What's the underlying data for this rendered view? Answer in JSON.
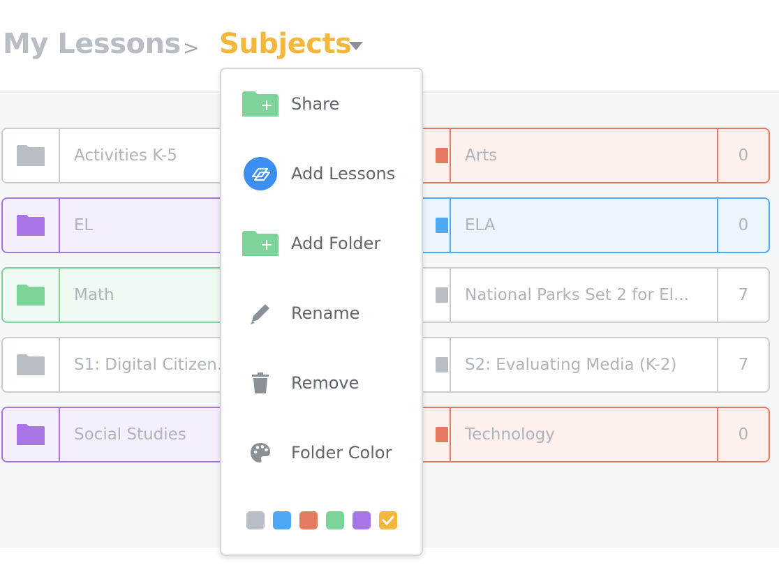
{
  "breadcrumb": {
    "root": "My Lessons",
    "separator": ">",
    "current": "Subjects"
  },
  "folders_left": [
    {
      "name": "Activities K-5",
      "theme": "gray"
    },
    {
      "name": "EL",
      "theme": "purple"
    },
    {
      "name": "Math",
      "theme": "green"
    },
    {
      "name": "S1: Digital Citizenship",
      "theme": "gray"
    },
    {
      "name": "Social Studies",
      "theme": "purple"
    }
  ],
  "folders_right": [
    {
      "name": "Arts",
      "count": "0",
      "theme": "red"
    },
    {
      "name": "ELA",
      "count": "0",
      "theme": "blue"
    },
    {
      "name": "National Parks Set 2 for El...",
      "count": "7",
      "theme": "gray"
    },
    {
      "name": "S2: Evaluating Media (K-2)",
      "count": "7",
      "theme": "gray"
    },
    {
      "name": "Technology",
      "count": "0",
      "theme": "red"
    }
  ],
  "menu": {
    "items": [
      {
        "label": "Share",
        "icon": "folder-plus-icon"
      },
      {
        "label": "Add Lessons",
        "icon": "nearpod-logo-icon"
      },
      {
        "label": "Add Folder",
        "icon": "folder-plus-icon"
      },
      {
        "label": "Rename",
        "icon": "pencil-icon"
      },
      {
        "label": "Remove",
        "icon": "trash-icon"
      },
      {
        "label": "Folder Color",
        "icon": "palette-icon"
      }
    ],
    "swatches": [
      {
        "color": "#b9bec4",
        "selected": false
      },
      {
        "color": "#4da8f5",
        "selected": false
      },
      {
        "color": "#e57a62",
        "selected": false
      },
      {
        "color": "#7dd49a",
        "selected": false
      },
      {
        "color": "#a875e6",
        "selected": false
      },
      {
        "color": "#f4b73e",
        "selected": true
      }
    ]
  },
  "colors": {
    "gray": "#b9bec4",
    "purple": "#a875e6",
    "green": "#7dd49a",
    "red": "#e57a62",
    "blue": "#4da8f5",
    "accent": "#f4b73e"
  }
}
